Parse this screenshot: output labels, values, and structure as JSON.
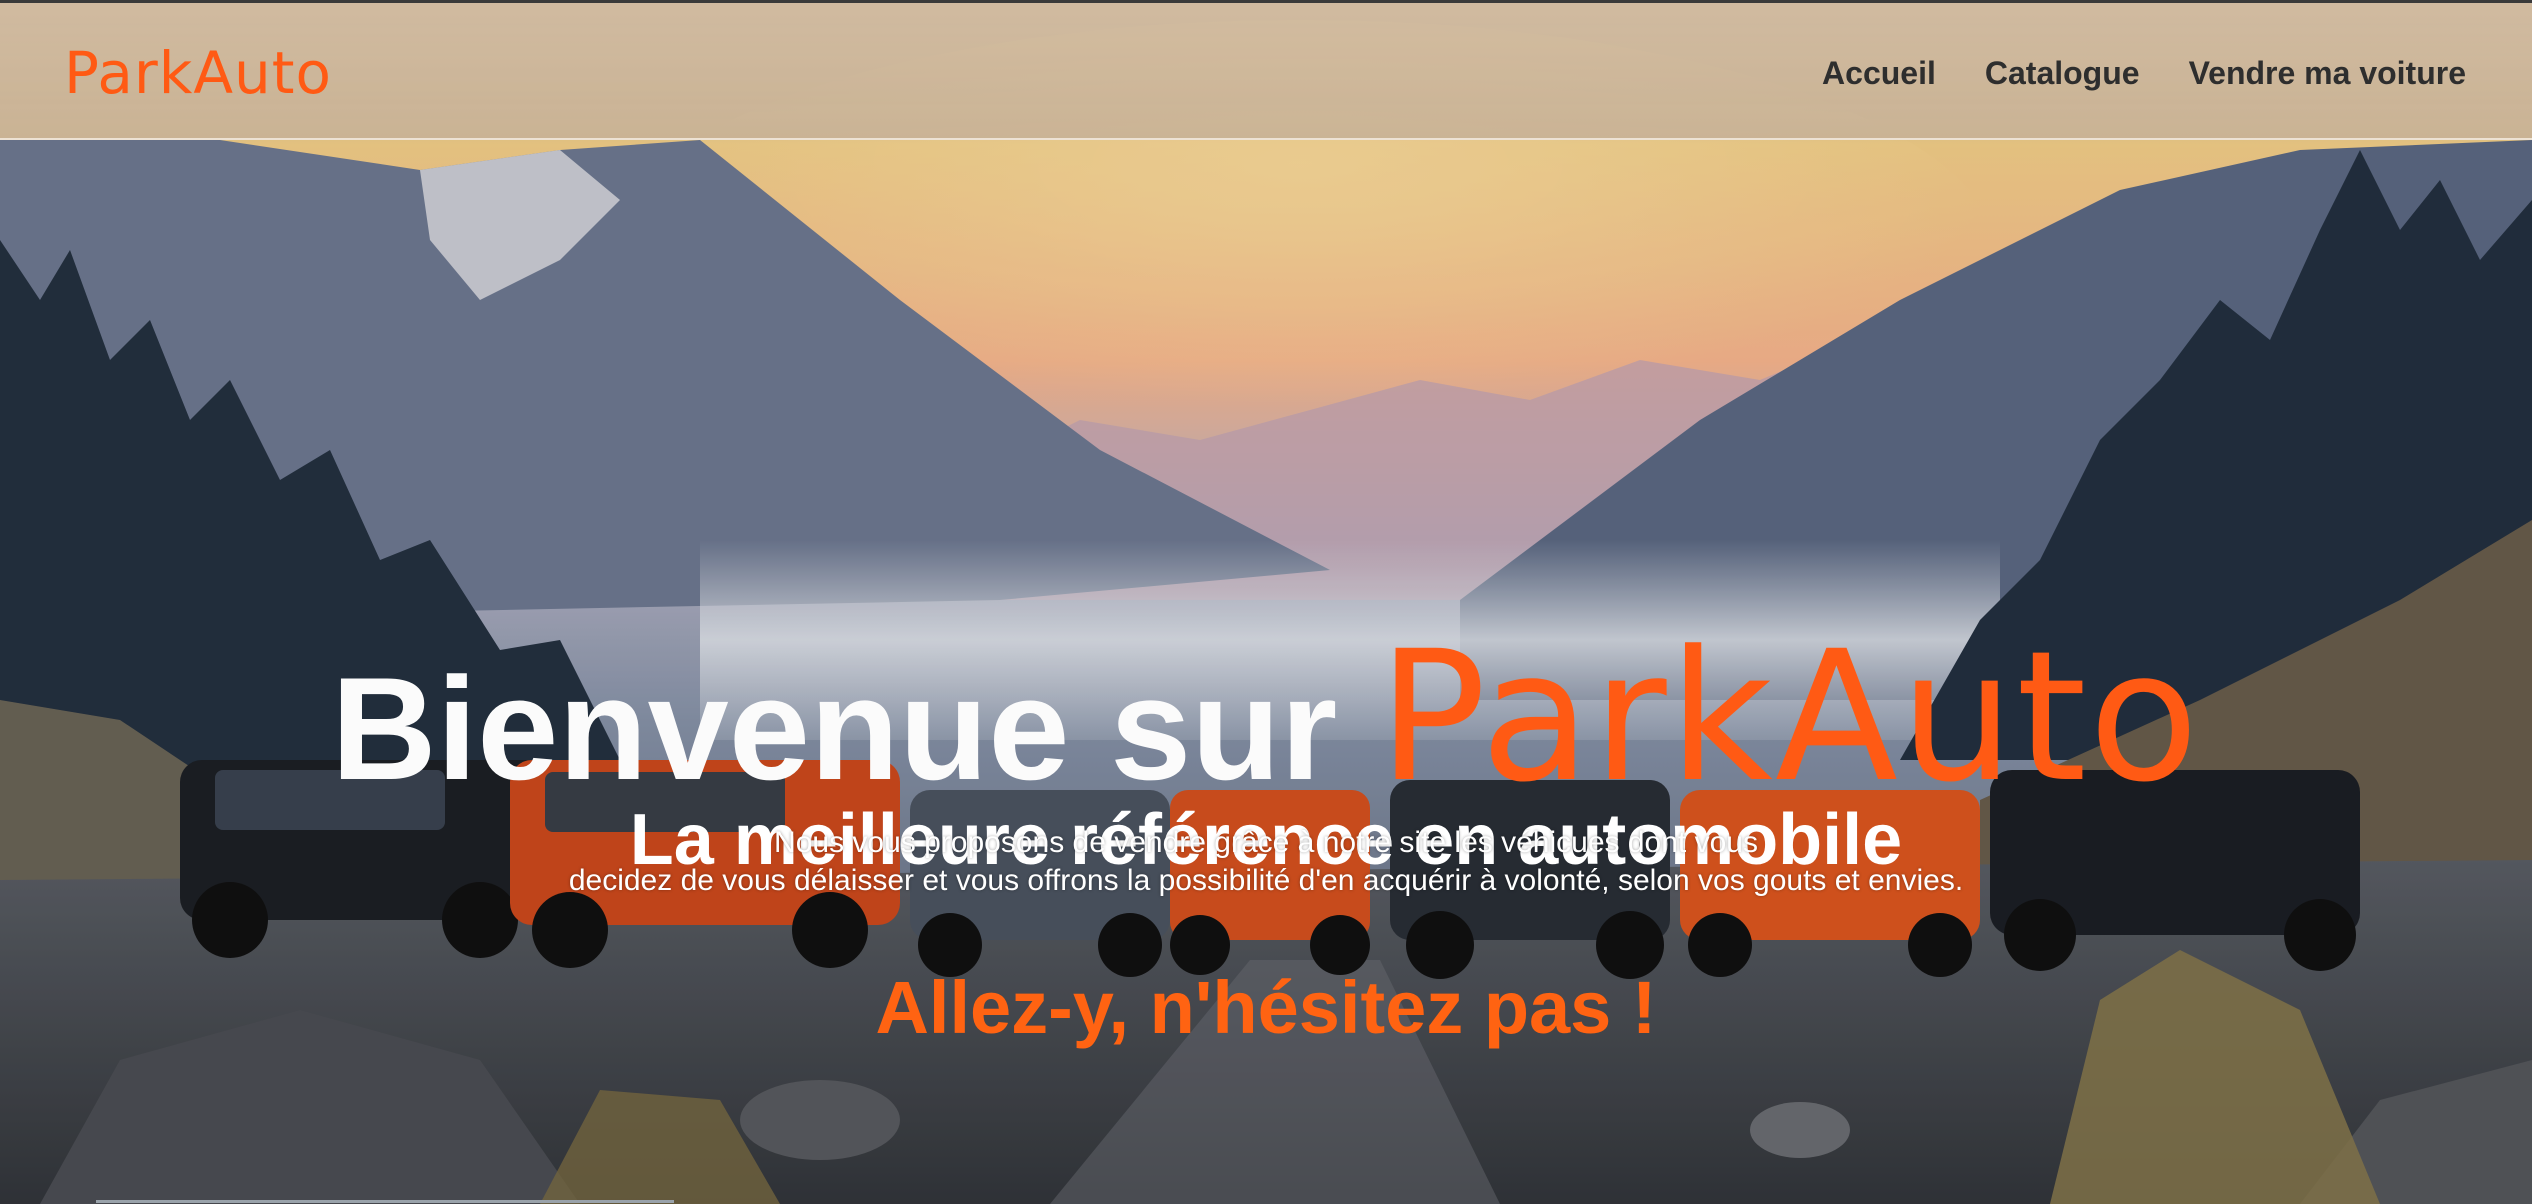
{
  "colors": {
    "brand": "#ff5a14",
    "cta": "#ff6312",
    "nav_text": "#2e2e2e",
    "navbar_bg": "#d6bea0",
    "hero_text": "#ffffff"
  },
  "nav": {
    "logo": "ParkAuto",
    "links": [
      "Accueil",
      "Catalogue",
      "Vendre ma voiture"
    ]
  },
  "hero": {
    "title_prefix": "Bienvenue sur",
    "title_brand": "ParkAuto",
    "subtitle": "La meilleure référence en automobile",
    "description_lines": [
      "Nous vous proposons de vendre grâce à notre site les véhicues dont vous",
      "decidez de vous délaisser et vous offrons la possibilité d'en acquérir à volonté, selon vos gouts et envies."
    ],
    "cta": "Allez-y, n'hésitez pas !"
  }
}
